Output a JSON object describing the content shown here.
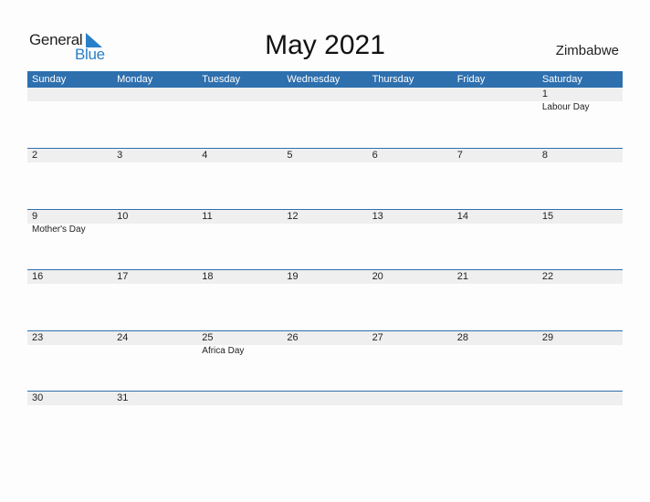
{
  "logo": {
    "word1": "General",
    "word2": "Blue"
  },
  "title": "May 2021",
  "country": "Zimbabwe",
  "colors": {
    "header_bg": "#2e6fae",
    "brand_blue": "#2a7fc9",
    "date_strip": "#efefef"
  },
  "weekdays": [
    "Sunday",
    "Monday",
    "Tuesday",
    "Wednesday",
    "Thursday",
    "Friday",
    "Saturday"
  ],
  "weeks": [
    {
      "days": [
        {
          "num": "",
          "holiday": ""
        },
        {
          "num": "",
          "holiday": ""
        },
        {
          "num": "",
          "holiday": ""
        },
        {
          "num": "",
          "holiday": ""
        },
        {
          "num": "",
          "holiday": ""
        },
        {
          "num": "",
          "holiday": ""
        },
        {
          "num": "1",
          "holiday": "Labour Day"
        }
      ]
    },
    {
      "days": [
        {
          "num": "2",
          "holiday": ""
        },
        {
          "num": "3",
          "holiday": ""
        },
        {
          "num": "4",
          "holiday": ""
        },
        {
          "num": "5",
          "holiday": ""
        },
        {
          "num": "6",
          "holiday": ""
        },
        {
          "num": "7",
          "holiday": ""
        },
        {
          "num": "8",
          "holiday": ""
        }
      ]
    },
    {
      "days": [
        {
          "num": "9",
          "holiday": "Mother's Day"
        },
        {
          "num": "10",
          "holiday": ""
        },
        {
          "num": "11",
          "holiday": ""
        },
        {
          "num": "12",
          "holiday": ""
        },
        {
          "num": "13",
          "holiday": ""
        },
        {
          "num": "14",
          "holiday": ""
        },
        {
          "num": "15",
          "holiday": ""
        }
      ]
    },
    {
      "days": [
        {
          "num": "16",
          "holiday": ""
        },
        {
          "num": "17",
          "holiday": ""
        },
        {
          "num": "18",
          "holiday": ""
        },
        {
          "num": "19",
          "holiday": ""
        },
        {
          "num": "20",
          "holiday": ""
        },
        {
          "num": "21",
          "holiday": ""
        },
        {
          "num": "22",
          "holiday": ""
        }
      ]
    },
    {
      "days": [
        {
          "num": "23",
          "holiday": ""
        },
        {
          "num": "24",
          "holiday": ""
        },
        {
          "num": "25",
          "holiday": "Africa Day"
        },
        {
          "num": "26",
          "holiday": ""
        },
        {
          "num": "27",
          "holiday": ""
        },
        {
          "num": "28",
          "holiday": ""
        },
        {
          "num": "29",
          "holiday": ""
        }
      ]
    },
    {
      "days": [
        {
          "num": "30",
          "holiday": ""
        },
        {
          "num": "31",
          "holiday": ""
        },
        {
          "num": "",
          "holiday": ""
        },
        {
          "num": "",
          "holiday": ""
        },
        {
          "num": "",
          "holiday": ""
        },
        {
          "num": "",
          "holiday": ""
        },
        {
          "num": "",
          "holiday": ""
        }
      ]
    }
  ]
}
